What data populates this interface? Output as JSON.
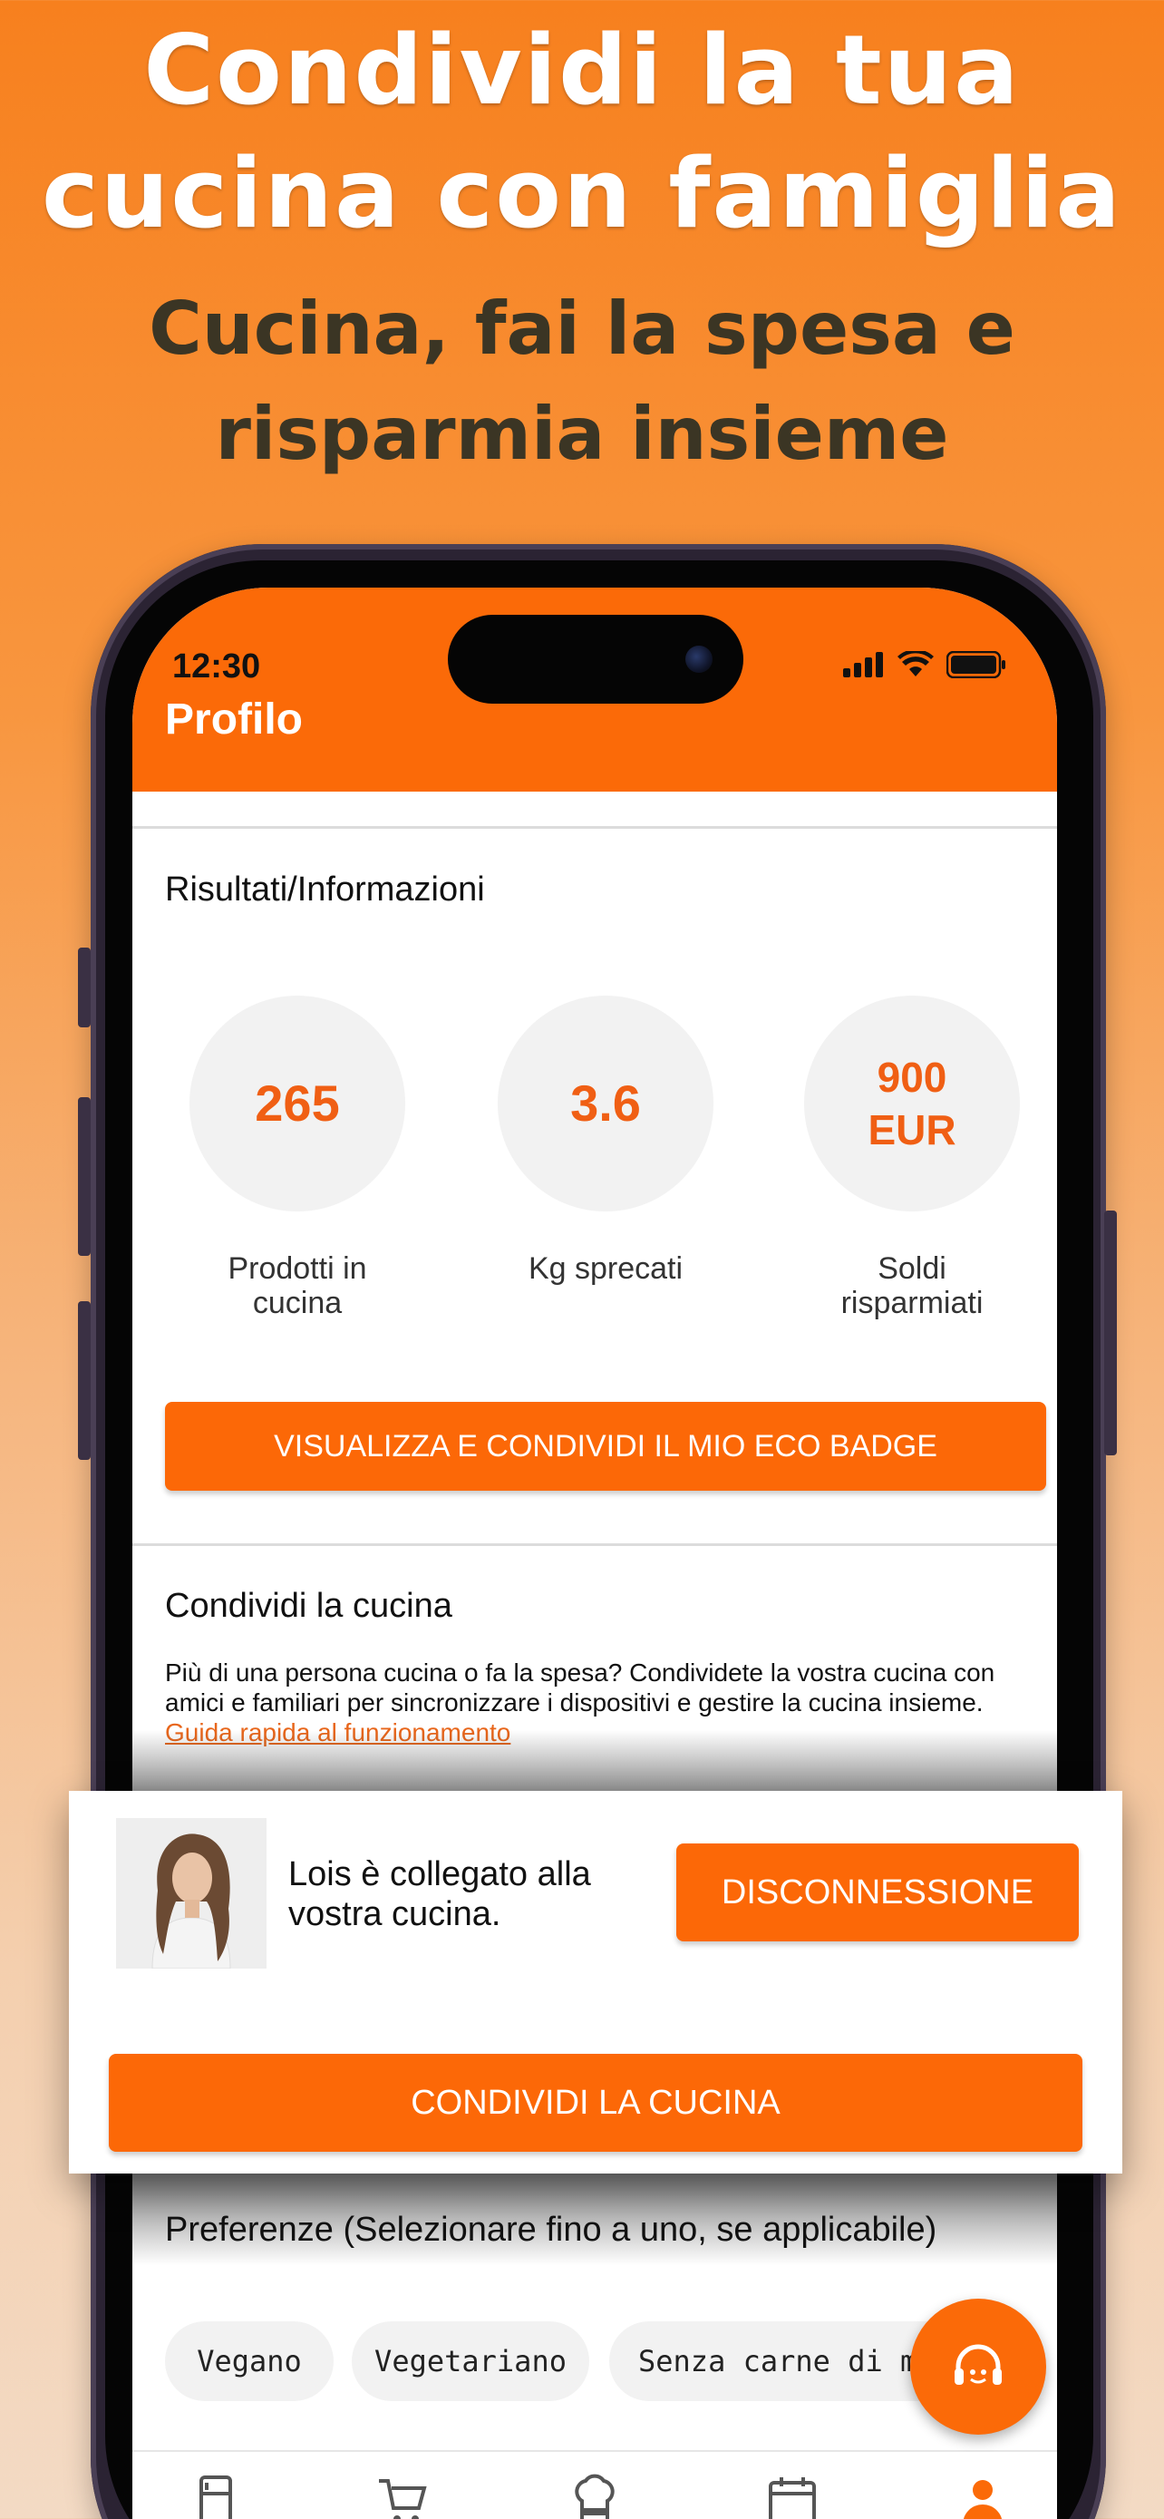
{
  "marketing": {
    "headline_line1": "Condividi la tua",
    "headline_line2": "cucina con famiglia",
    "subline_line1": "Cucina, fai la spesa e",
    "subline_line2": "risparmia insieme"
  },
  "status_bar": {
    "time": "12:30"
  },
  "app_bar": {
    "title": "Profilo"
  },
  "results": {
    "title": "Risultati/Informazioni",
    "stats": [
      {
        "value": "265",
        "label_line1": "Prodotti in",
        "label_line2": "cucina"
      },
      {
        "value": "3.6",
        "label_line1": "Kg sprecati",
        "label_line2": ""
      },
      {
        "value_line1": "900",
        "value_line2": "EUR",
        "label_line1": "Soldi",
        "label_line2": "risparmiati"
      }
    ],
    "eco_badge_button": "VISUALIZZA E CONDIVIDI IL MIO ECO BADGE"
  },
  "share": {
    "title": "Condividi la cucina",
    "description": "Più di una persona cucina o fa la spesa? Condividete la vostra cucina con amici e familiari per sincronizzare i dispositivi e gestire la cucina insieme.",
    "guide_link": "Guida rapida al funzionamento",
    "connected_text": "Lois è collegato alla vostra cucina.",
    "disconnect_button": "DISCONNESSIONE",
    "share_button": "CONDIVIDI LA CUCINA"
  },
  "preferences": {
    "title": "Preferenze (Selezionare fino a uno, se applicabile)",
    "chips": [
      "Vegano",
      "Vegetariano",
      "Senza carne di mai"
    ]
  },
  "nav": {
    "items": [
      "fridge-icon",
      "cart-icon",
      "chef-hat-icon",
      "calendar-icon",
      "profile-icon"
    ],
    "active": "profile-icon"
  },
  "colors": {
    "accent": "#fb6a08",
    "stat_text": "#f05f14",
    "link": "#e8661b"
  }
}
